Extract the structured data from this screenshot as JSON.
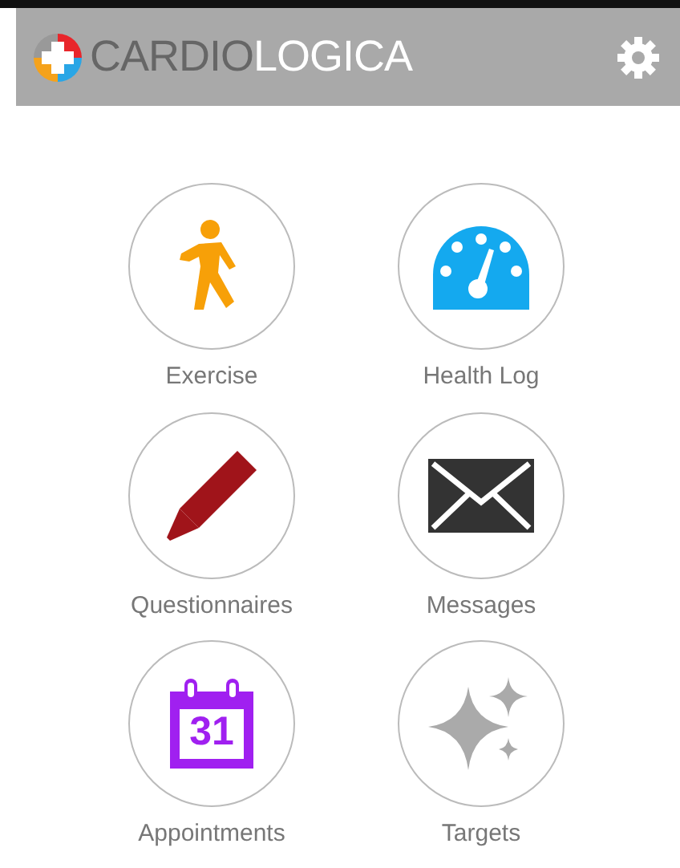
{
  "header": {
    "title_dark": "CARDIO",
    "title_light": "LOGICA"
  },
  "tiles": [
    {
      "kind": "exercise",
      "label": "Exercise"
    },
    {
      "kind": "gauge",
      "label": "Health Log"
    },
    {
      "kind": "pen",
      "label": "Questionnaires"
    },
    {
      "kind": "mail",
      "label": "Messages"
    },
    {
      "kind": "calendar",
      "label": "Appointments",
      "icon_text": "31"
    },
    {
      "kind": "sparkle",
      "label": "Targets"
    }
  ]
}
